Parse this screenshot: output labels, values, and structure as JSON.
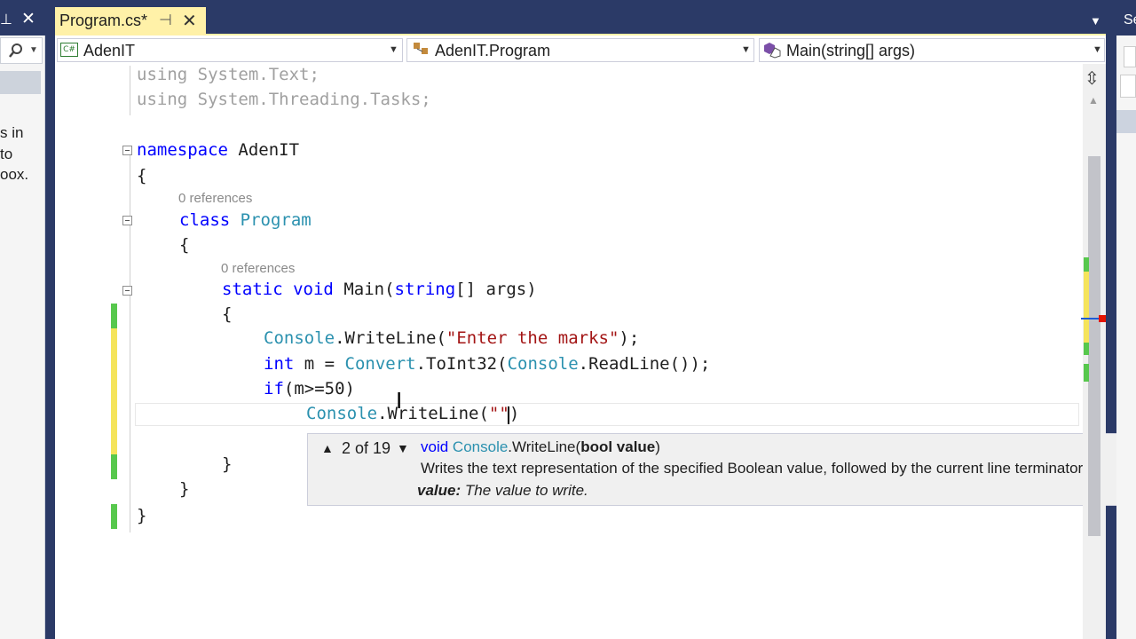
{
  "left_panel": {
    "pin_icon": "pin-icon",
    "close_icon": "close-icon",
    "search_icon": "search-icon",
    "text_lines": [
      "s in",
      "to",
      "oox."
    ]
  },
  "tab": {
    "title": "Program.cs*",
    "pin_icon": "pin-icon",
    "close_icon": "close-icon",
    "close_glyph": "✕"
  },
  "nav": {
    "project": "AdenIT",
    "class": "AdenIT.Program",
    "member": "Main(string[] args)"
  },
  "code": {
    "using_text": "using System.Text;",
    "using_tasks": "using System.Threading.Tasks;",
    "ns_kw": "namespace",
    "ns_name": "AdenIT",
    "brace_open": "{",
    "brace_close": "}",
    "refs_class": "0 references",
    "class_kw": "class",
    "class_name": "Program",
    "refs_main": "0 references",
    "main_static": "static",
    "main_void": "void",
    "main_name": "Main(",
    "main_string": "string",
    "main_rest": "[] args)",
    "l1_console": "Console",
    "l1_mid": ".WriteLine(",
    "l1_str": "\"Enter the marks\"",
    "l1_end": ");",
    "l2_int": "int",
    "l2_mid": " m = ",
    "l2_convert": "Convert",
    "l2_to": ".ToInt32(",
    "l2_console": "Console",
    "l2_end": ".ReadLine());",
    "l3_if": "if",
    "l3_rest": "(m>=50)",
    "l4_console": "Console",
    "l4_mid": ".WriteLine(",
    "l4_str": "\"\"",
    "l4_end": ")"
  },
  "tooltip": {
    "counter": "2 of 19",
    "sig_void": "void",
    "sig_console": "Console",
    "sig_method": ".WriteLine(",
    "sig_param": "bool value",
    "sig_close": ")",
    "description": "Writes the text representation of the specified Boolean value, followed by the current line terminator",
    "param_name": "value:",
    "param_desc": "The value to write."
  },
  "right_panel": {
    "text": "Se"
  },
  "colors": {
    "keyword": "#0000ff",
    "type": "#2b91af",
    "string": "#a31515",
    "change_saved": "#57c84d",
    "change_unsaved": "#f5e45b",
    "tab_active": "#fff1a8"
  }
}
